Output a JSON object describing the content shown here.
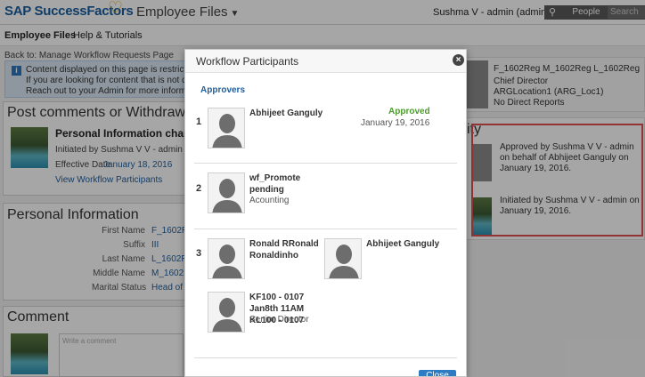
{
  "header": {
    "logo": "SAP SuccessFactors",
    "module": "Employee Files",
    "user": "Sushma V - admin (adminsv1)",
    "search_scope": "People",
    "search_placeholder": "Search"
  },
  "subnav": {
    "employee_files": "Employee Files",
    "help": "Help & Tutorials"
  },
  "back_link": "Back to: Manage Workflow Requests Page",
  "banner": {
    "line1": "Content displayed on this page is restricted base",
    "line2": "If you are looking for content that is not displayed",
    "line3": "Reach out to your Admin for more information on"
  },
  "post_card": {
    "title": "Post comments or Withdraw re",
    "request_title": "Personal Information change For",
    "initiated": "Initiated by Sushma V V - admin on January",
    "effective_label": "Effective Date",
    "effective_date": "January 18, 2016",
    "view_link": "View Workflow Participants"
  },
  "personal_info": {
    "title": "Personal Information",
    "fields": [
      {
        "label": "First Name",
        "value": "F_1602Re"
      },
      {
        "label": "Suffix",
        "value": "III"
      },
      {
        "label": "Last Name",
        "value": "L_1602Re"
      },
      {
        "label": "Middle Name",
        "value": "M_1602Re"
      },
      {
        "label": "Marital Status",
        "value": "Head of H"
      }
    ]
  },
  "comment": {
    "title": "Comment",
    "placeholder": "Write a comment"
  },
  "employee": {
    "name": "F_1602Reg M_1602Reg L_1602Reg",
    "title": "Chief Director",
    "location": "ARGLocation1 (ARG_Loc1)",
    "reports": "No Direct Reports"
  },
  "activity": {
    "title": "tivity",
    "items": [
      {
        "text": "Approved by Sushma V V - admin on behalf of Abhijeet Ganguly on January 19, 2016."
      },
      {
        "text": "Initiated by Sushma V V - admin on January 19, 2016."
      }
    ]
  },
  "modal": {
    "title": "Workflow Participants",
    "section": "Approvers",
    "steps": [
      {
        "number": "1",
        "participants": [
          {
            "name": "Abhijeet Ganguly",
            "sub": ""
          }
        ],
        "status": "Approved",
        "date": "January 19, 2016"
      },
      {
        "number": "2",
        "participants": [
          {
            "name": "wf_Promote pending",
            "sub": "Acounting"
          }
        ]
      },
      {
        "number": "3",
        "participants": [
          {
            "name": "Ronald RRonald Ronaldinho",
            "sub": ""
          },
          {
            "name": "Abhijeet Ganguly",
            "sub": ""
          },
          {
            "name": "KF100 - 0107 Jan8th 11AM KL100 - 0107",
            "sub": "Senior Director"
          }
        ]
      }
    ],
    "close_label": "Close"
  },
  "colors": {
    "brand_blue": "#1a5fa0",
    "approved_green": "#4e9a2f",
    "highlight_red": "#e05050",
    "button_blue": "#2c7bc3"
  }
}
